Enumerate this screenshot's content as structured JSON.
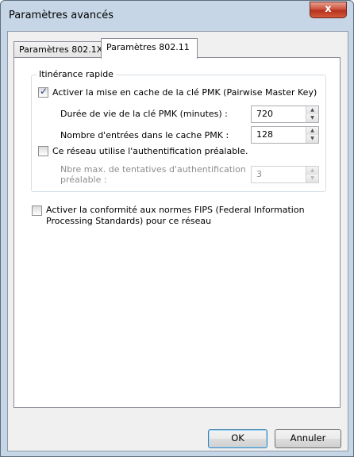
{
  "window": {
    "title": "Paramètres avancés",
    "close_label": "x"
  },
  "tabs": [
    {
      "label": "Paramètres 802.1X",
      "selected": false
    },
    {
      "label": "Paramètres 802.11",
      "selected": true
    }
  ],
  "fast_roaming": {
    "group_title": "Itinérance rapide",
    "pmk_cache_checkbox": {
      "label": "Activer la mise en cache de la clé PMK (Pairwise Master Key)",
      "checked": true
    },
    "pmk_lifetime": {
      "label": "Durée de vie de la clé PMK (minutes) :",
      "value": "720"
    },
    "pmk_entries": {
      "label": "Nombre d'entrées dans le cache PMK :",
      "value": "128"
    },
    "preauth_checkbox": {
      "label": "Ce réseau utilise l'authentification préalable.",
      "checked": false
    },
    "preauth_attempts": {
      "label_line1": "Nbre max. de tentatives d'authentification",
      "label_line2": "préalable :",
      "value": "3",
      "disabled": true
    }
  },
  "fips": {
    "checked": false,
    "label_line1": "Activer la conformité aux normes FIPS (Federal Information",
    "label_line2": "Processing Standards) pour ce réseau"
  },
  "buttons": {
    "ok": "OK",
    "cancel": "Annuler"
  }
}
